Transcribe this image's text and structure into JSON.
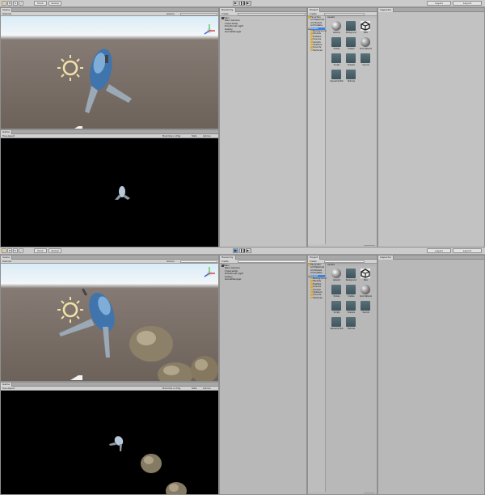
{
  "toolbar": {
    "transform_tools": [
      "✋",
      "✥",
      "↻",
      "⤢"
    ],
    "pivot_label": "Pivot",
    "space_label": "Global",
    "layers_label": "Layers",
    "layout_label": "Layout"
  },
  "scene": {
    "tab_label": "Scene",
    "shading_label": "Textured",
    "gizmos_label": "Gizmos"
  },
  "game": {
    "tab_label": "Game",
    "aspect_label": "Free Aspect",
    "maximize_label": "Maximize on Play",
    "stats_label": "Stats",
    "gizmos_label": "Gizmos"
  },
  "hierarchy": {
    "tab_label": "Hierarchy",
    "create_label": "Create",
    "items": [
      "Main",
      "Main Camera",
      "Spaceship",
      "Directional Light",
      "Galaxy",
      "GameManager"
    ]
  },
  "project": {
    "tab_label": "Project",
    "create_label": "Create",
    "tree": [
      {
        "label": "Favorites",
        "icon": "folder-icon"
      },
      {
        "label": "All Materials",
        "icon": "search-icon"
      },
      {
        "label": "All Models",
        "icon": "search-icon"
      },
      {
        "label": "All Prefabs",
        "icon": "search-icon"
      },
      {
        "label": "Assets",
        "icon": "folder-icon"
      },
      {
        "label": "Background",
        "icon": "folder-icon"
      },
      {
        "label": "Models",
        "icon": "folder-icon"
      },
      {
        "label": "Prefabs",
        "icon": "folder-icon"
      },
      {
        "label": "Scenes",
        "icon": "folder-icon"
      },
      {
        "label": "Scripts",
        "icon": "folder-icon"
      },
      {
        "label": "Shaders",
        "icon": "folder-icon"
      },
      {
        "label": "Sounds",
        "icon": "folder-icon"
      },
      {
        "label": "Textures",
        "icon": "folder-icon"
      }
    ],
    "assets_header": "Assets",
    "assets": [
      {
        "label": "Asteroid",
        "thumb": "sphere"
      },
      {
        "label": "Background",
        "thumb": "folder"
      },
      {
        "label": "Main",
        "thumb": "unity"
      },
      {
        "label": "Models",
        "thumb": "folder"
      },
      {
        "label": "Prefabs",
        "thumb": "folder"
      },
      {
        "label": "Rock Material",
        "thumb": "material"
      },
      {
        "label": "Scripts",
        "thumb": "folder"
      },
      {
        "label": "Shaders",
        "thumb": "folder"
      },
      {
        "label": "Sounds",
        "thumb": "folder"
      },
      {
        "label": "Spaceship Mat",
        "thumb": "folder"
      },
      {
        "label": "Textures",
        "thumb": "folder"
      }
    ]
  },
  "inspector": {
    "tab_label": "Inspector"
  }
}
